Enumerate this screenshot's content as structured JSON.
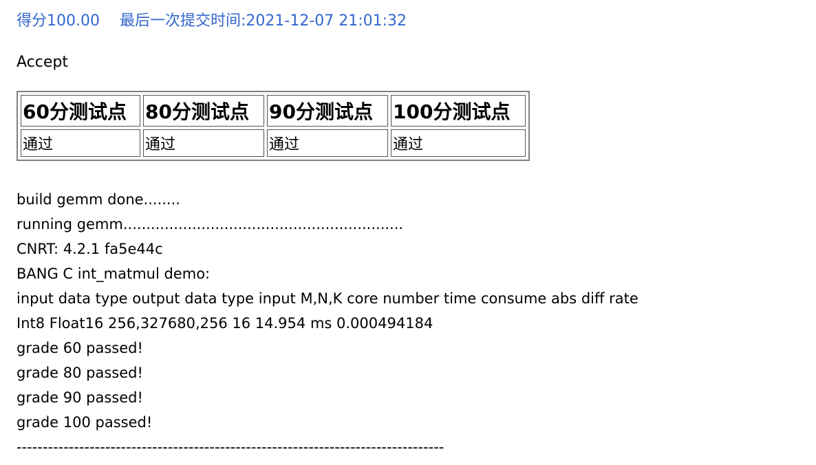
{
  "header": {
    "score": "得分100.00",
    "submit_time": "最后一次提交时间:2021-12-07 21:01:32"
  },
  "status": "Accept",
  "results_table": {
    "headers": [
      "60分测试点",
      "80分测试点",
      "90分测试点",
      "100分测试点"
    ],
    "values": [
      "通过",
      "通过",
      "通过",
      "通过"
    ]
  },
  "log_lines": [
    "build gemm done........",
    "running gemm.............................................................",
    "CNRT: 4.2.1 fa5e44c",
    "BANG C int_matmul demo:",
    "input data type output data type input M,N,K core number time consume abs diff rate",
    "Int8 Float16 256,327680,256 16 14.954 ms 0.000494184",
    "grade 60 passed!",
    "grade 80 passed!",
    "grade 90 passed!",
    "grade 100 passed!",
    "----------------------------------------------------------------------------------"
  ],
  "colors": {
    "header_text": "#3366cc"
  }
}
